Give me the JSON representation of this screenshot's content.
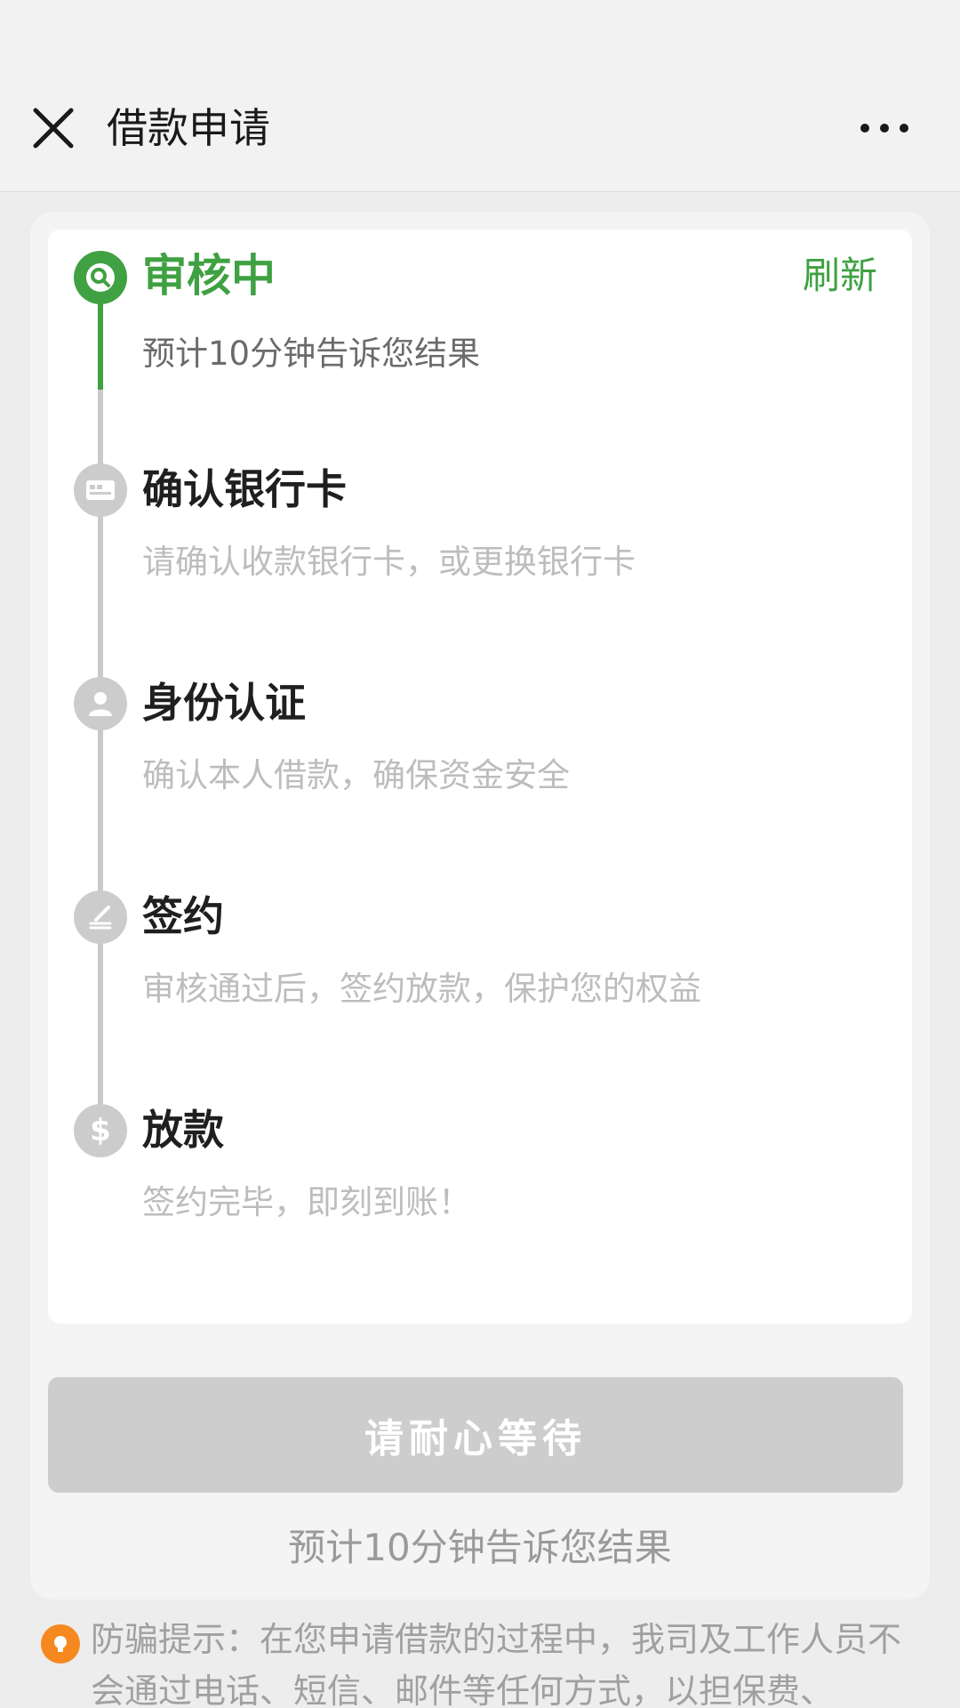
{
  "nav": {
    "title": "借款申请",
    "close_icon": "close-icon",
    "more_icon": "more-icon"
  },
  "refresh_label": "刷新",
  "steps": [
    {
      "title": "审核中",
      "desc": "预计10分钟告诉您结果",
      "icon": "search-icon",
      "status": "active"
    },
    {
      "title": "确认银行卡",
      "desc": "请确认收款银行卡，或更换银行卡",
      "icon": "bank-card-icon",
      "status": "pending"
    },
    {
      "title": "身份认证",
      "desc": "确认本人借款，确保资金安全",
      "icon": "person-icon",
      "status": "pending"
    },
    {
      "title": "签约",
      "desc": "审核通过后，签约放款，保护您的权益",
      "icon": "sign-pen-icon",
      "status": "pending"
    },
    {
      "title": "放款",
      "desc": "签约完毕，即刻到账！",
      "icon": "dollar-icon",
      "status": "pending"
    }
  ],
  "wait_button_label": "请耐心等待",
  "bottom_hint": "预计10分钟告诉您结果",
  "fraud_notice": "防骗提示：在您申请借款的过程中，我司及工作人员不会通过电话、短信、邮件等任何方式，以担保费、",
  "colors": {
    "accent": "#3fa142",
    "pending": "#cccccc",
    "warning": "#f5891f"
  }
}
